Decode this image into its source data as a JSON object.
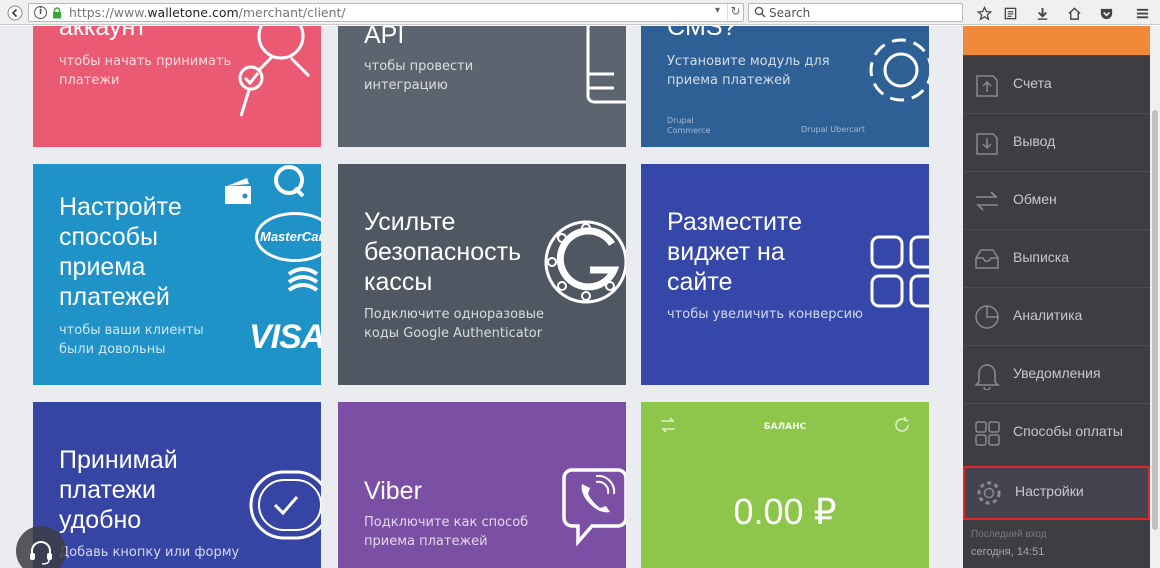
{
  "browser": {
    "url_prefix": "https://www.",
    "url_domain": "walletone.com",
    "url_path": "/merchant/client/",
    "search_placeholder": "Search"
  },
  "tiles": {
    "t1": {
      "title": "аккаунт",
      "subtitle": "чтобы начать принимать платежи",
      "color": "#ea5b73"
    },
    "t2": {
      "title": "API",
      "subtitle": "чтобы провести интеграцию",
      "color": "#5c6470"
    },
    "t3": {
      "title": "CMS?",
      "subtitle": "Установите модуль для приема платежей",
      "drupal1": "Drupal Commerce",
      "drupal2": "Drupal Ubercart",
      "color": "#2e5f95"
    },
    "t4": {
      "title": "Настройте способы приема платежей",
      "subtitle": "чтобы ваши клиенты были довольны",
      "mastercard": "MasterCard",
      "visa": "VISA",
      "color": "#1f93c8"
    },
    "t5": {
      "title": "Усильте безопасность кассы",
      "subtitle": "Подключите одноразовые коды Google Authenticator",
      "color": "#4f5763"
    },
    "t6": {
      "title": "Разместите виджет на сайте",
      "subtitle": "чтобы увеличить конверсию",
      "color": "#3547a8"
    },
    "t7": {
      "title": "Принимай платежи удобно",
      "subtitle": "Добавь кнопку или форму",
      "color": "#3645a3"
    },
    "t8": {
      "title": "Viber",
      "subtitle": "Подключите как способ приема платежей",
      "color": "#7b4fa3"
    },
    "t9": {
      "label": "БАЛАНС",
      "amount": "0.00 ₽",
      "color": "#8dc64b"
    }
  },
  "sidebar": {
    "items": [
      {
        "label": "Счета",
        "icon": "invoice-icon"
      },
      {
        "label": "Вывод",
        "icon": "withdraw-icon"
      },
      {
        "label": "Обмен",
        "icon": "exchange-icon"
      },
      {
        "label": "Выписка",
        "icon": "statement-icon"
      },
      {
        "label": "Аналитика",
        "icon": "analytics-icon"
      },
      {
        "label": "Уведомления",
        "icon": "bell-icon"
      },
      {
        "label": "Способы оплаты",
        "icon": "grid-icon"
      },
      {
        "label": "Настройки",
        "icon": "gear-icon"
      }
    ],
    "last_login_label": "Последний вход",
    "last_login_value": "сегодня, 14:51"
  },
  "colors": {
    "sidebar_bg": "#3d3d42",
    "accent_orange": "#f08a3a",
    "active_border": "#e3262a"
  }
}
